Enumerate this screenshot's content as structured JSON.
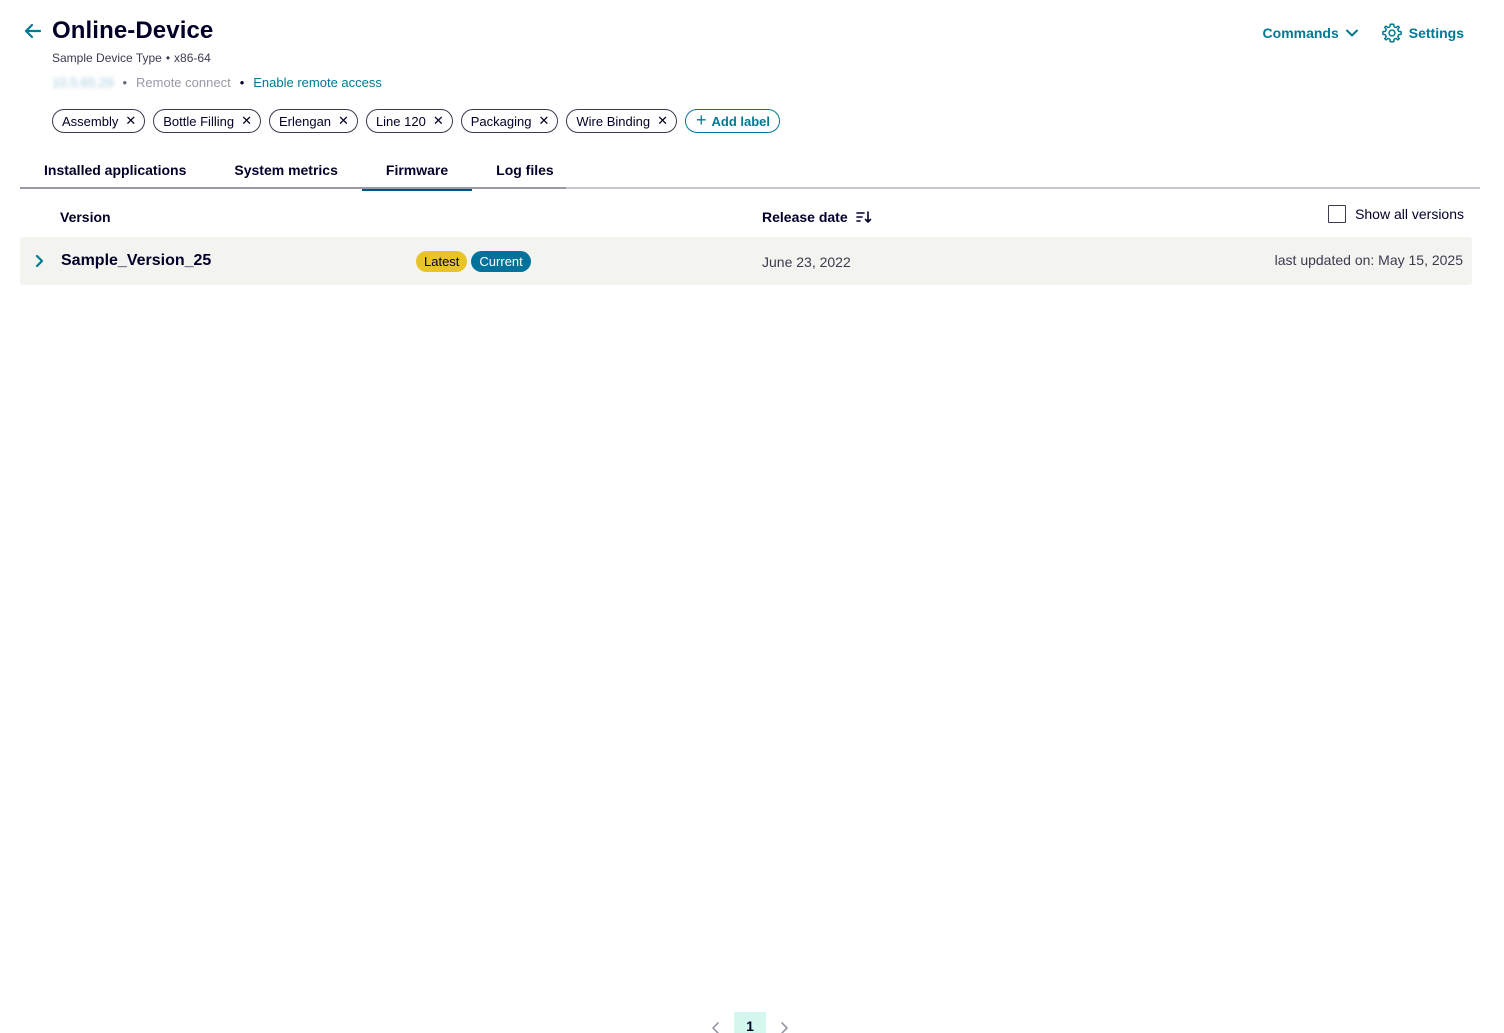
{
  "header": {
    "title": "Online-Device",
    "device_type": "Sample Device Type",
    "arch": "x86-64",
    "ip_address": "10.5.65.29",
    "remote_connect": "Remote connect",
    "enable_remote": "Enable remote access",
    "commands_label": "Commands",
    "settings_label": "Settings",
    "accent_color": "#007993"
  },
  "labels": [
    {
      "name": "Assembly"
    },
    {
      "name": "Bottle Filling"
    },
    {
      "name": "Erlengan"
    },
    {
      "name": "Line 120"
    },
    {
      "name": "Packaging"
    },
    {
      "name": "Wire Binding"
    }
  ],
  "add_label": "Add label",
  "tabs": [
    {
      "label": "Installed applications"
    },
    {
      "label": "System metrics"
    },
    {
      "label": "Firmware",
      "active": true
    },
    {
      "label": "Log files"
    }
  ],
  "table": {
    "col_version": "Version",
    "col_release": "Release date",
    "show_all_label": "Show all versions",
    "show_all_checked": false,
    "rows": [
      {
        "version": "Sample_Version_25",
        "badge_latest": "Latest",
        "badge_current": "Current",
        "release_date": "June 23, 2022",
        "last_updated": "last updated on: May 15, 2025"
      }
    ]
  },
  "pagination": {
    "current_page": "1"
  },
  "icons": {
    "back": "arrow-left-icon",
    "commands": "chevron-down-icon",
    "settings": "gear-icon",
    "sort": "sort-icon",
    "expand": "chevron-right-icon",
    "remove": "close-icon",
    "add": "plus-icon"
  }
}
